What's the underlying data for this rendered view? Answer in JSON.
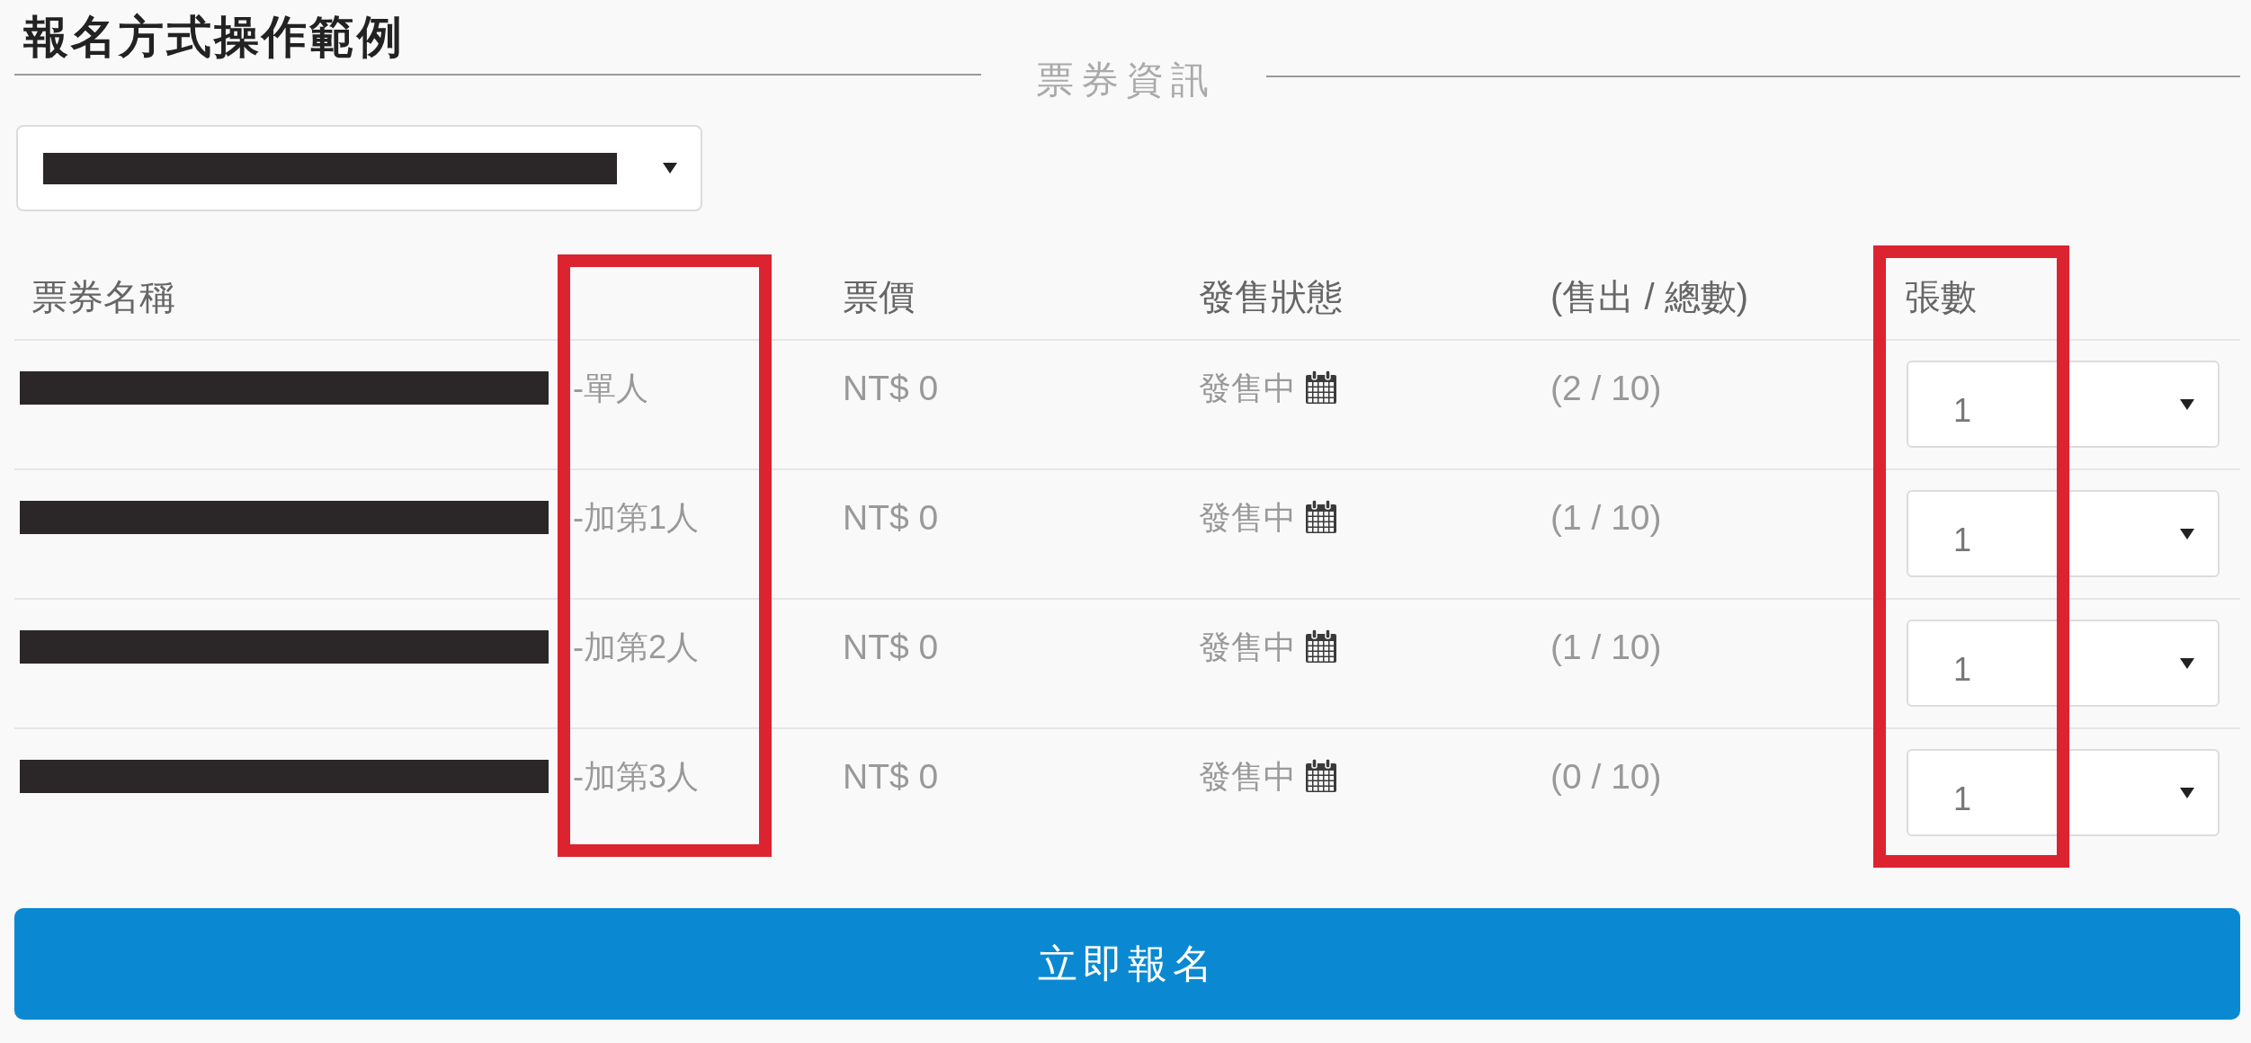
{
  "title": "報名方式操作範例",
  "section": {
    "legend": "票券資訊"
  },
  "event_select": {
    "value_redacted": true
  },
  "table": {
    "columns": [
      "票券名稱",
      "票價",
      "發售狀態",
      "(售出 / 總數)",
      "張數"
    ],
    "rows": [
      {
        "name": "-單人",
        "name_redacted": true,
        "price": "NT$ 0",
        "status": "發售中",
        "sold_total": "(2 / 10)",
        "quantity": "1"
      },
      {
        "name": "-加第1人",
        "name_redacted": true,
        "price": "NT$ 0",
        "status": "發售中",
        "sold_total": "(1 / 10)",
        "quantity": "1"
      },
      {
        "name": "-加第2人",
        "name_redacted": true,
        "price": "NT$ 0",
        "status": "發售中",
        "sold_total": "(1 / 10)",
        "quantity": "1"
      },
      {
        "name": "-加第3人",
        "name_redacted": true,
        "price": "NT$ 0",
        "status": "發售中",
        "sold_total": "(0 / 10)",
        "quantity": "1"
      }
    ]
  },
  "highlight_frames": {
    "name_suffix_column": true,
    "quantity_column": true
  },
  "submit_button": {
    "label": "立即報名"
  }
}
